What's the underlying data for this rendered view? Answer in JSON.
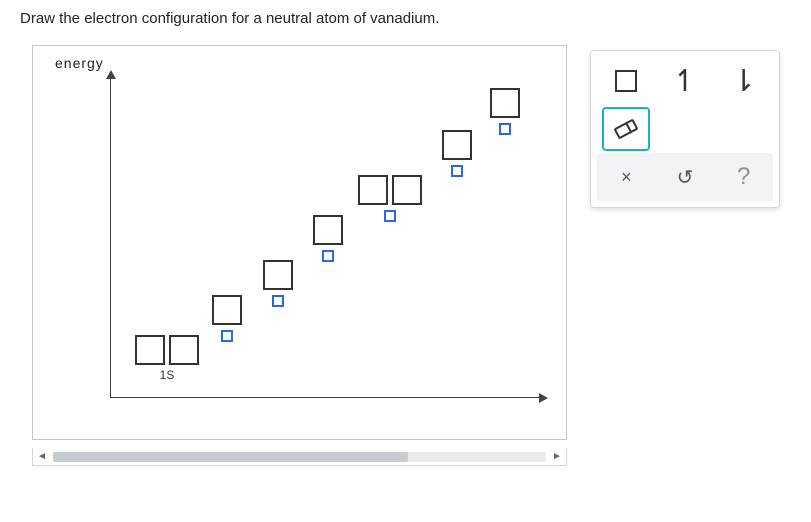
{
  "prompt": "Draw the electron configuration for a neutral atom of vanadium.",
  "axis_label": "energy",
  "orbitals": {
    "o1": {
      "label": "1S"
    }
  },
  "palette": {
    "box_tool": "orbital-box",
    "up_tool": "spin-up",
    "down_tool": "spin-down",
    "eraser_tool": "eraser",
    "clear": "×",
    "reset": "↺",
    "help": "?"
  }
}
